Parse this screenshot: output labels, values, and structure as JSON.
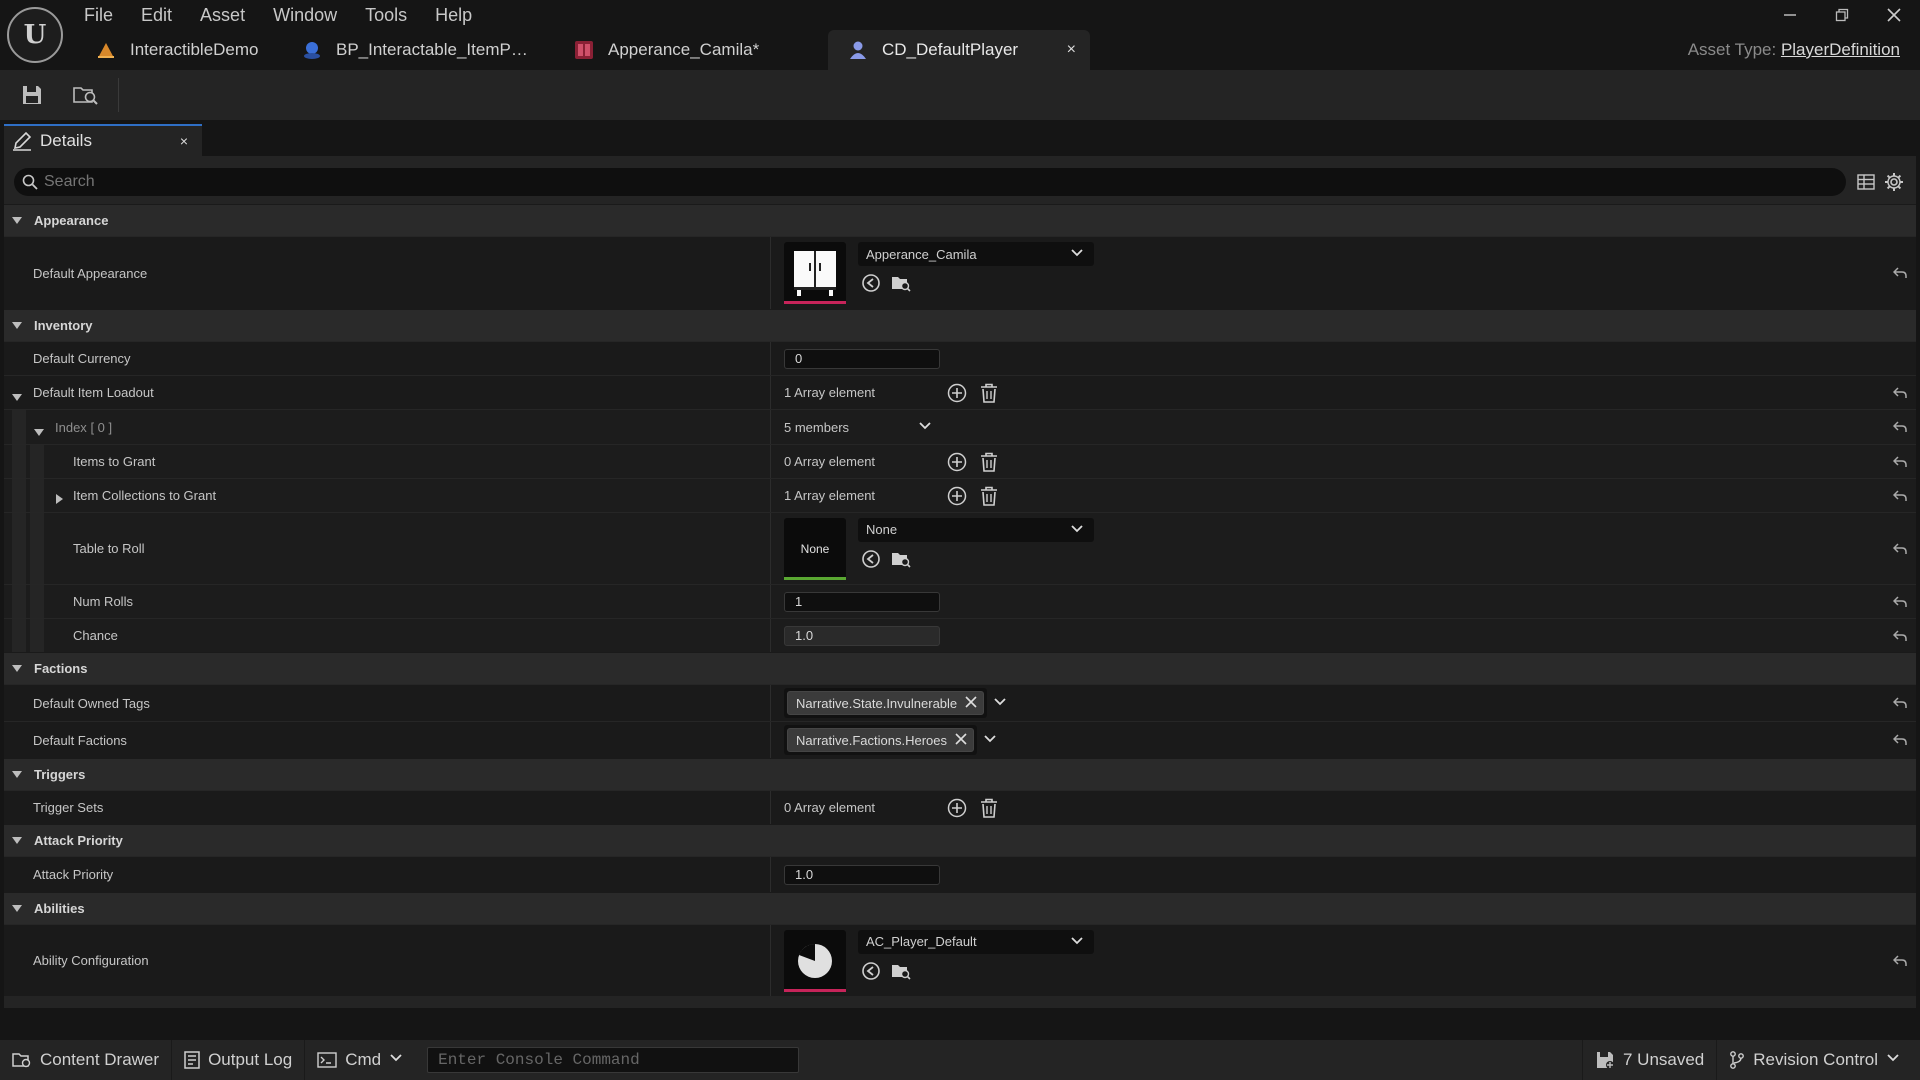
{
  "menu": [
    "File",
    "Edit",
    "Asset",
    "Window",
    "Tools",
    "Help"
  ],
  "logo_text": "U",
  "doc_tabs": [
    {
      "label": "InteractibleDemo",
      "icon": "level-icon",
      "color": "#d8882a"
    },
    {
      "label": "BP_Interactable_ItemP…",
      "icon": "blueprint-icon",
      "color": "#3a6fd8"
    },
    {
      "label": "Apperance_Camila*",
      "icon": "data-asset-icon",
      "color": "#b0304a"
    },
    {
      "label": "CD_DefaultPlayer",
      "icon": "character-icon",
      "color": "#7a8adb",
      "active": true,
      "close": "×"
    }
  ],
  "asset_type": {
    "label": "Asset Type:",
    "value": "PlayerDefinition"
  },
  "details_tab": {
    "label": "Details",
    "close": "×"
  },
  "search": {
    "placeholder": "Search"
  },
  "sections": {
    "appearance": "Appearance",
    "inventory": "Inventory",
    "factions": "Factions",
    "triggers": "Triggers",
    "attack_priority": "Attack Priority",
    "abilities": "Abilities"
  },
  "props": {
    "default_appearance": {
      "label": "Default Appearance",
      "value": "Apperance_Camila"
    },
    "default_currency": {
      "label": "Default Currency",
      "value": "0"
    },
    "default_item_loadout": {
      "label": "Default Item Loadout",
      "value": "1 Array element"
    },
    "index0": {
      "label": "Index",
      "index": "[ 0 ]",
      "value": "5 members"
    },
    "items_to_grant": {
      "label": "Items to Grant",
      "value": "0 Array element"
    },
    "item_collections": {
      "label": "Item Collections to Grant",
      "value": "1 Array element"
    },
    "table_to_roll": {
      "label": "Table to Roll",
      "value": "None",
      "thumb": "None"
    },
    "num_rolls": {
      "label": "Num Rolls",
      "value": "1"
    },
    "chance": {
      "label": "Chance",
      "value": "1.0"
    },
    "default_owned_tags": {
      "label": "Default Owned Tags",
      "tag": "Narrative.State.Invulnerable"
    },
    "default_factions": {
      "label": "Default Factions",
      "tag": "Narrative.Factions.Heroes"
    },
    "trigger_sets": {
      "label": "Trigger Sets",
      "value": "0 Array element"
    },
    "attack_priority": {
      "label": "Attack Priority",
      "value": "1.0"
    },
    "ability_configuration": {
      "label": "Ability Configuration",
      "value": "AC_Player_Default"
    }
  },
  "status": {
    "content_drawer": "Content Drawer",
    "output_log": "Output Log",
    "cmd": "Cmd",
    "console_placeholder": "Enter Console Command",
    "unsaved": "7 Unsaved",
    "revision_control": "Revision Control"
  },
  "colors": {
    "accent": "#2f6fc6",
    "asset_underline_pink": "#c7245a",
    "asset_underline_green": "#5aa832"
  }
}
